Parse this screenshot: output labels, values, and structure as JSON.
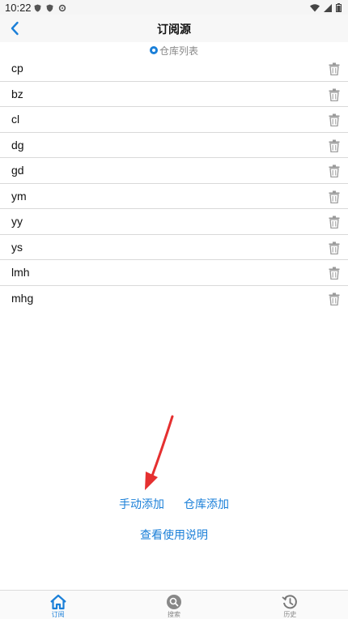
{
  "status": {
    "time": "10:22"
  },
  "header": {
    "title": "订阅源",
    "back_icon": "chevron-left-icon"
  },
  "subhead": {
    "label": "仓库列表"
  },
  "list": {
    "items": [
      {
        "label": "cp"
      },
      {
        "label": "bz"
      },
      {
        "label": "cl"
      },
      {
        "label": "dg"
      },
      {
        "label": "gd"
      },
      {
        "label": "ym"
      },
      {
        "label": "yy"
      },
      {
        "label": "ys"
      },
      {
        "label": "lmh"
      },
      {
        "label": "mhg"
      }
    ],
    "delete_icon": "trash-icon"
  },
  "actions": {
    "manual_add": "手动添加",
    "repo_add": "仓库添加",
    "help": "查看使用说明"
  },
  "tabbar": {
    "tabs": [
      {
        "label": "订阅",
        "icon": "home-icon",
        "active": true
      },
      {
        "label": "搜索",
        "icon": "search-icon",
        "active": false
      },
      {
        "label": "历史",
        "icon": "history-icon",
        "active": false
      }
    ]
  },
  "colors": {
    "accent": "#1a7fd8",
    "annotation_arrow": "#e53030"
  }
}
